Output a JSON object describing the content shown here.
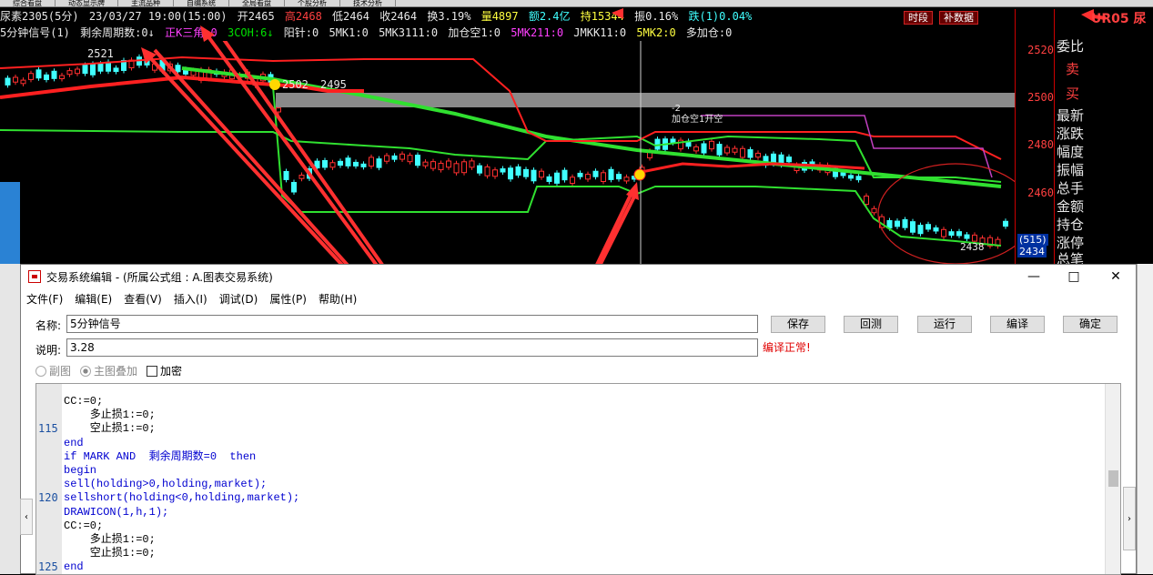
{
  "tabs": [
    "综合看盘",
    "动态显示牌",
    "主流品种",
    "自编系统",
    "全局看盘",
    "个股分析",
    "技术分析"
  ],
  "info": {
    "symbol": "尿素2305(5分)",
    "datetime": "23/03/27 19:00(15:00)",
    "open": "开2465",
    "high": "高2468",
    "low": "低2464",
    "close": "收2464",
    "turnover": "换3.19%",
    "volume": "量4897",
    "amount": "额2.4亿",
    "hold": "持15344",
    "amplitude": "振0.16%",
    "change": "跌(1)0.04%"
  },
  "toolbar_buttons": {
    "period": "时段",
    "supplement": "补数据"
  },
  "indicator_line": {
    "name": "5分钟信号(1)",
    "remaining": "剩余周期数:0↓",
    "tri": "正K三角:0",
    "coh": "3COH:6↓",
    "yang": "阳针:0",
    "mk1": "5MK1:0",
    "mk3111": "5MK3111:0",
    "addshort": "加仓空1:0",
    "mk211": "5MK211:0",
    "jmkk": "JMKK11:0",
    "mk2": "5MK2:0",
    "addlong": "多加仓:0"
  },
  "chart_annotations": {
    "a2521": "2521",
    "a2495": "2495",
    "a2502": "2502",
    "a_minus2": "-2",
    "a_addshort": "加仓空1开空",
    "a2438": "2438"
  },
  "price_axis": {
    "ticks": [
      "2520",
      "2500",
      "2480",
      "2460"
    ],
    "cur1": "(515)",
    "cur2": "2434"
  },
  "side_panel": {
    "title": "UR05 尿",
    "items": [
      "委比",
      "卖",
      "买",
      "最新",
      "涨跌",
      "幅度",
      "振幅",
      "总手",
      "金额",
      "持仓",
      "涨停",
      "总笔"
    ]
  },
  "dialog": {
    "title": "交易系统编辑 - (所属公式组 : A.图表交易系统)",
    "menu": [
      "文件(F)",
      "编辑(E)",
      "查看(V)",
      "插入(I)",
      "调试(D)",
      "属性(P)",
      "帮助(H)"
    ],
    "name_label": "名称:",
    "name_value": "5分钟信号",
    "desc_label": "说明:",
    "desc_value": "3.28",
    "compile_status": "编译正常!",
    "buttons": {
      "save": "保存",
      "backtest": "回测",
      "run": "运行",
      "compile": "编译",
      "ok": "确定"
    },
    "opt_sub": "副图",
    "opt_main": "主图叠加",
    "opt_encrypt": "加密"
  },
  "code": {
    "line_numbers": {
      "l115": "115",
      "l120": "120",
      "l125": "125"
    },
    "lines": [
      "CC:=0;",
      "    多止损1:=0;",
      "    空止损1:=0;",
      "end",
      "if MARK AND  剩余周期数=0  then",
      "begin",
      "sell(holding>0,holding,market);",
      "sellshort(holding<0,holding,market);",
      "DRAWICON(1,h,1);",
      "CC:=0;",
      "    多止损1:=0;",
      "    空止损1:=0;",
      "end"
    ]
  },
  "colors": {
    "up": "#ff3030",
    "down": "#40ffff",
    "ma_red": "#ff2020",
    "ma_green": "#30e030",
    "band": "#909090"
  }
}
